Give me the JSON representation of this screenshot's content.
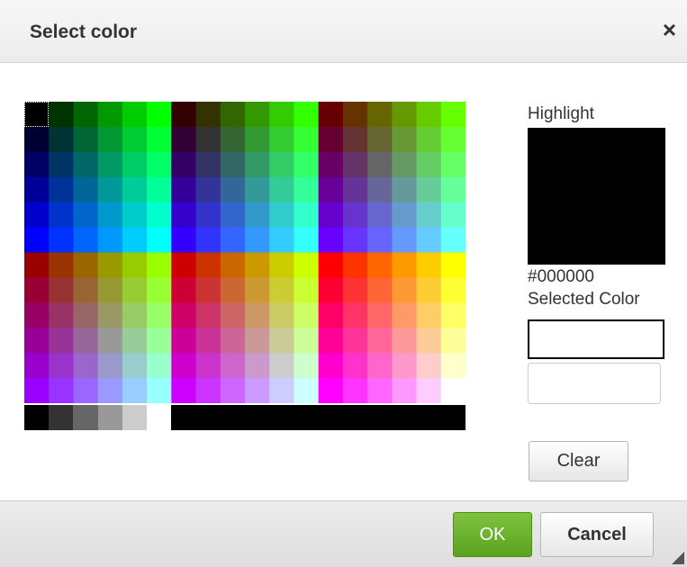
{
  "dialog": {
    "title": "Select color",
    "close_symbol": "×"
  },
  "palette": {
    "columns": 18,
    "rows": 12,
    "steps": [
      "00",
      "33",
      "66",
      "99",
      "CC",
      "FF"
    ],
    "grays": [
      "#000000",
      "#333333",
      "#666666",
      "#999999",
      "#CCCCCC",
      "#FFFFFF"
    ],
    "selected_cell": "#000000"
  },
  "right_panel": {
    "highlight_label": "Highlight",
    "highlight_color": "#000000",
    "highlight_value": "#000000",
    "selected_label": "Selected Color",
    "selected_color": "#FFFFFF",
    "input_value": "",
    "clear_label": "Clear"
  },
  "footer": {
    "ok_label": "OK",
    "cancel_label": "Cancel"
  },
  "colors": {
    "ok_green": "#6BB52E",
    "titlebar": "#F2F2F2"
  }
}
